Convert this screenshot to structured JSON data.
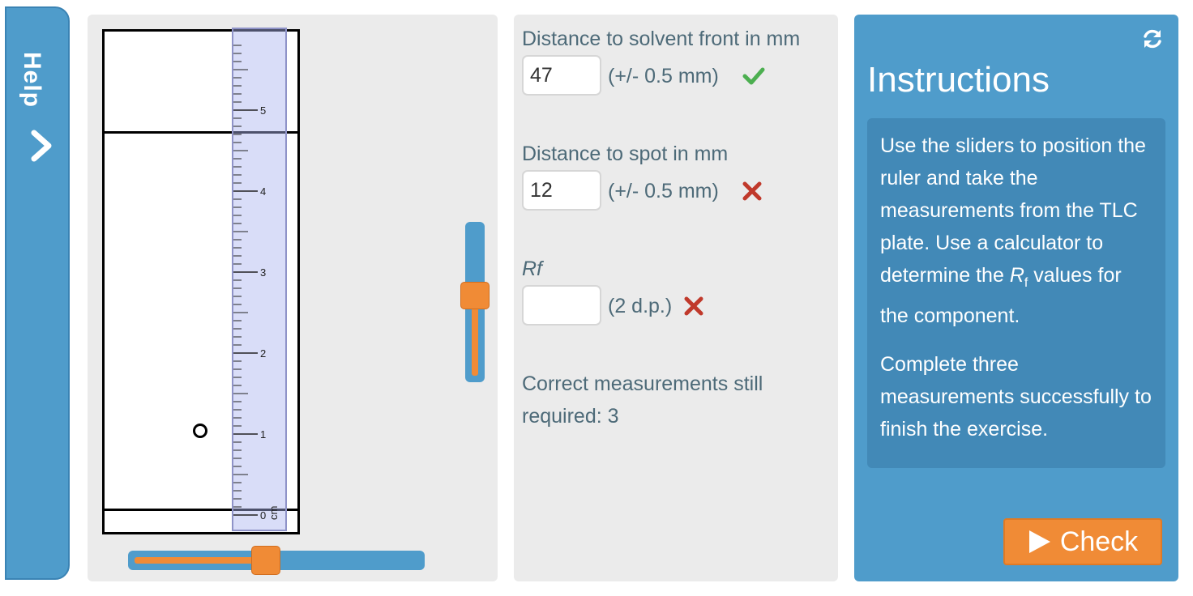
{
  "help": {
    "label": "Help"
  },
  "plate": {
    "ruler": {
      "tick_labels": [
        "0",
        "1",
        "2",
        "3",
        "4",
        "5"
      ],
      "unit_label": "cm"
    },
    "vertical_slider": {
      "value": 0.55
    },
    "horizontal_slider": {
      "value": 0.46
    }
  },
  "measurements": {
    "solvent_front": {
      "label": "Distance to solvent front in mm",
      "value": "47",
      "tolerance": "(+/- 0.5 mm)",
      "status": "correct"
    },
    "spot": {
      "label": "Distance to spot in mm",
      "value": "12",
      "tolerance": "(+/- 0.5 mm)",
      "status": "incorrect"
    },
    "rf": {
      "label": "Rf",
      "value": "",
      "tolerance": "(2 d.p.)",
      "status": "incorrect"
    },
    "remaining": "Correct measurements still required: 3"
  },
  "instructions": {
    "title": "Instructions",
    "para1_before": "Use the sliders to position the ruler and take the measurements from the TLC plate. Use a calculator to determine the ",
    "rf_symbol": "R",
    "rf_subscript": "f",
    "para1_after": " values for the component.",
    "para2": "Complete three measurements successfully to finish the exercise."
  },
  "check_button": {
    "label": "Check"
  },
  "colors": {
    "panel_blue": "#4f9ccb",
    "accent_orange": "#f08b36",
    "correct_green": "#4caf50",
    "incorrect_red": "#c0392b"
  },
  "icons": {
    "refresh": "refresh-icon",
    "help_chevron": "chevron-right-icon",
    "correct": "checkmark-icon",
    "incorrect": "cross-icon",
    "check": "play-triangle-icon"
  }
}
